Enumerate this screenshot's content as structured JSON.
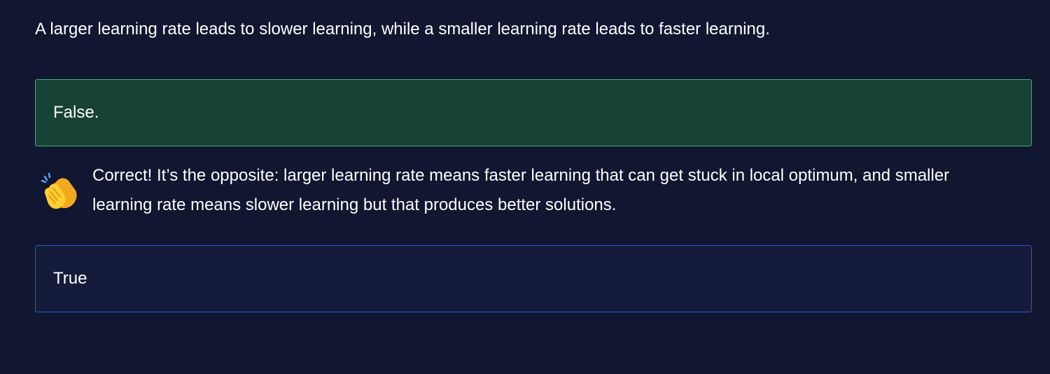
{
  "question": {
    "text": "A larger learning rate leads to slower learning, while a smaller learning rate leads to faster learning."
  },
  "options": [
    {
      "label": "False.",
      "state": "correct-selected"
    },
    {
      "label": "True",
      "state": "unselected"
    }
  ],
  "feedback": {
    "icon": "clapping-hands-icon",
    "text": "Correct! It’s the opposite: larger learning rate means faster learning that can get stuck in local optimum, and smaller learning rate means slower learning but that produces better solutions."
  },
  "colors": {
    "background": "#111631",
    "correct_fill": "#174334",
    "correct_border": "#3fae7f",
    "option_fill": "#151c3b",
    "option_border": "#2f55c9",
    "text": "#ffffff"
  }
}
